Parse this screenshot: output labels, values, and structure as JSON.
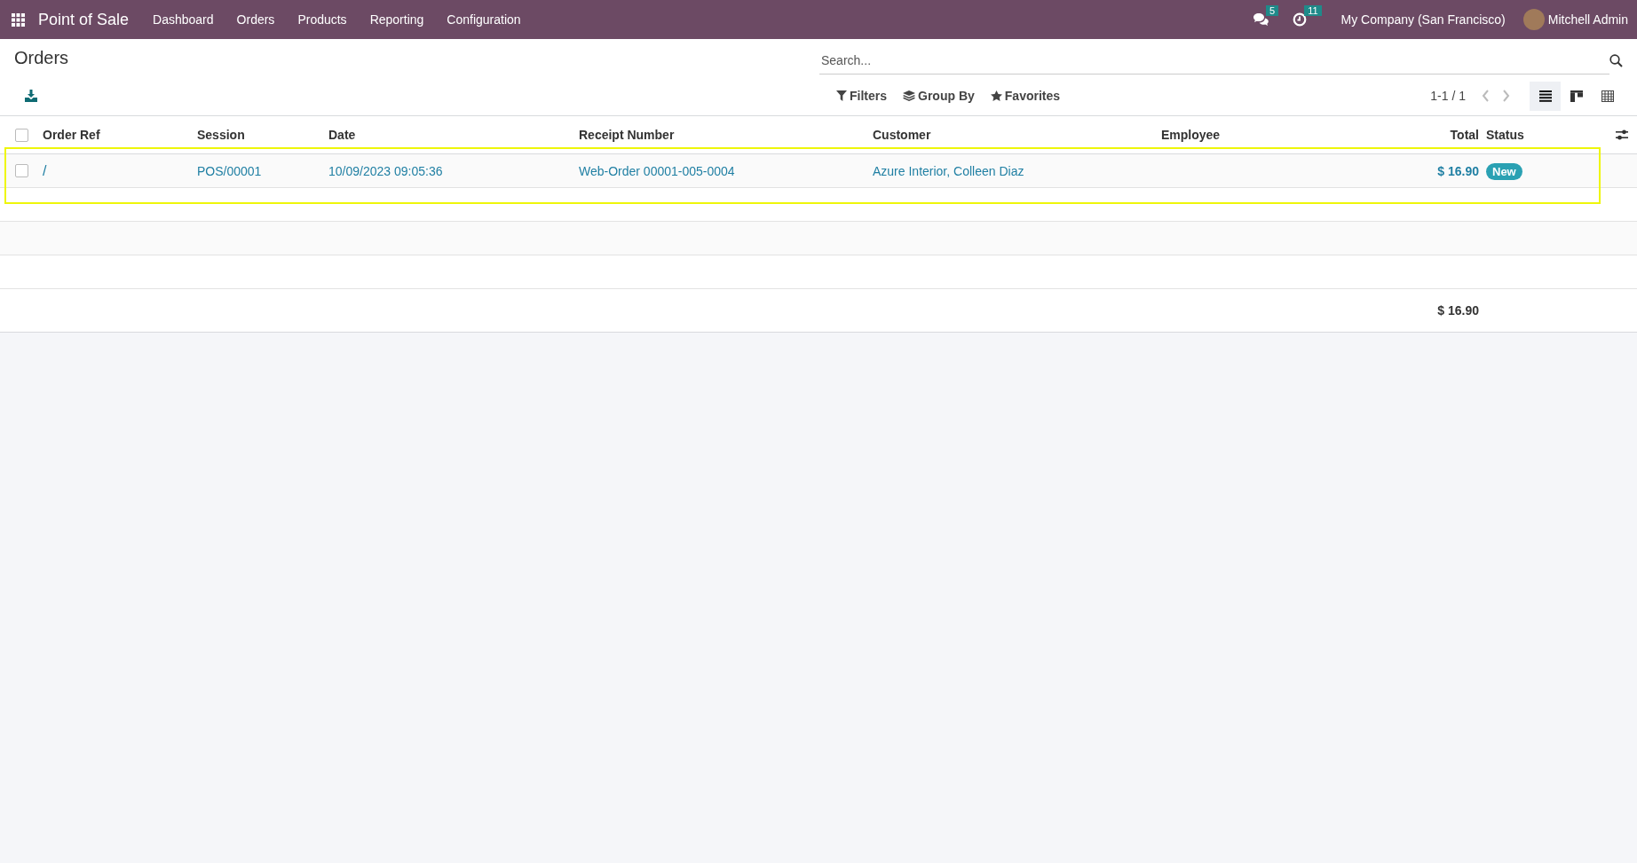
{
  "navbar": {
    "app_name": "Point of Sale",
    "menu": [
      "Dashboard",
      "Orders",
      "Products",
      "Reporting",
      "Configuration"
    ],
    "messages_count": "5",
    "activities_count": "11",
    "company": "My Company (San Francisco)",
    "user": "Mitchell Admin"
  },
  "control_panel": {
    "title": "Orders",
    "search": {
      "placeholder": "Search..."
    },
    "filters": [
      {
        "kind": "filter",
        "label": "Filters"
      },
      {
        "kind": "group",
        "label": "Group By"
      },
      {
        "kind": "star",
        "label": "Favorites"
      }
    ],
    "pager": "1-1 / 1",
    "views": [
      {
        "kind": "list",
        "selected": true
      },
      {
        "kind": "kanban",
        "selected": false
      },
      {
        "kind": "pivot",
        "selected": false
      }
    ]
  },
  "table": {
    "columns": [
      "Order Ref",
      "Session",
      "Date",
      "Receipt Number",
      "Customer",
      "Employee",
      "Total",
      "Status"
    ],
    "rows": [
      {
        "checked": false,
        "order_ref": "/",
        "session": "POS/00001",
        "date": "10/09/2023 09:05:36",
        "receipt_number": "Web-Order 00001-005-0004",
        "customer": "Azure Interior, Colleen Diaz",
        "total": "$ 16.90",
        "status": "New",
        "highlighted": true
      }
    ],
    "select_all_checked": false,
    "sum_total": "$ 16.90"
  }
}
